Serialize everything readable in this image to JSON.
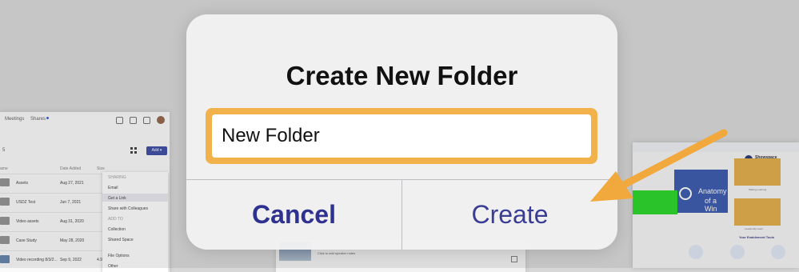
{
  "background": {
    "left_window": {
      "nav": [
        "Meetings",
        "Shares"
      ],
      "count": "5",
      "add_label": "Add ▾",
      "columns": {
        "name": "ame",
        "date": "Date Added",
        "size": "Size"
      },
      "rows": [
        {
          "name": "Assets",
          "date": "Aug 27, 2021",
          "size": ""
        },
        {
          "name": "USDZ Test",
          "date": "Jun 7, 2021",
          "size": ""
        },
        {
          "name": "Video assets",
          "date": "Aug 31, 2020",
          "size": ""
        },
        {
          "name": "Case Study",
          "date": "May 28, 2020",
          "size": ""
        },
        {
          "name": "Video recording 8/3/2...",
          "date": "Sep 9, 2022",
          "size": "4.9"
        }
      ],
      "menu": {
        "sharing_header": "SHARING",
        "email": "Email",
        "get_link": "Get a Link",
        "share_colleagues": "Share with Colleagues",
        "add_to_header": "ADD TO",
        "collection": "Collection",
        "shared_space": "Shared Space",
        "file_options": "File Options",
        "other": "Other"
      }
    },
    "mid_window": {
      "caption": "Click to add speaker notes"
    },
    "right_window": {
      "title": "Showspace",
      "hero_line1": "Anatomy",
      "hero_line2": "of a Win",
      "card_label_1": "Making Learning",
      "card_label_2": "Leadership Learn",
      "tools_title": "Your Enablement Tools"
    }
  },
  "dialog": {
    "title": "Create New Folder",
    "input_value": "New Folder",
    "cancel_label": "Cancel",
    "create_label": "Create"
  },
  "colors": {
    "accent_orange": "#f1b24c",
    "button_text": "#2f3190",
    "dialog_bg": "#f2f2f3"
  }
}
